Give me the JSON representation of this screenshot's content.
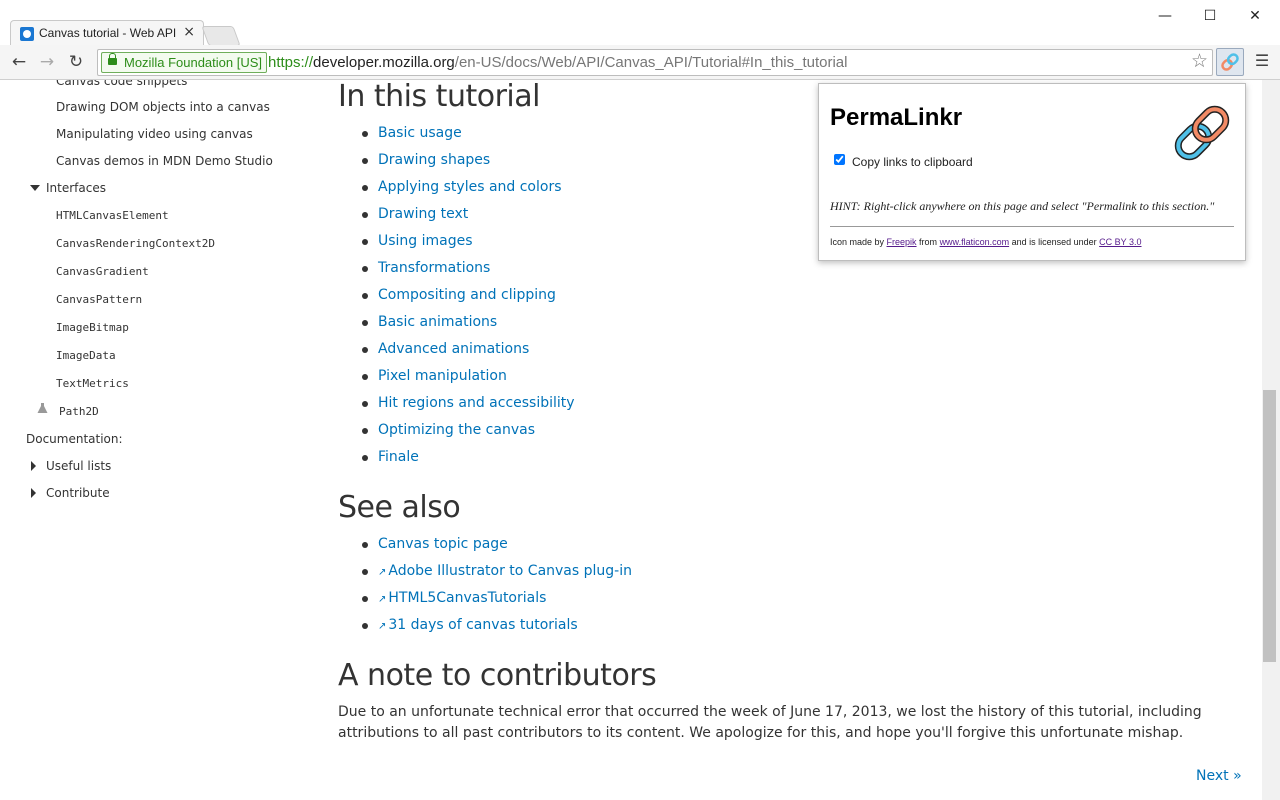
{
  "browser": {
    "tab_title": "Canvas tutorial - Web API",
    "tab_close": "×",
    "window_minimize": "—",
    "window_maximize": "☐",
    "window_close": "✕",
    "ev_badge": "Mozilla Foundation [US]",
    "url_scheme": "https://",
    "url_host": "developer.mozilla.org",
    "url_path": "/en-US/docs/Web/API/Canvas_API/Tutorial#In_this_tutorial",
    "icons": [
      "back-arrow-icon",
      "forward-arrow-icon",
      "reload-icon",
      "lock-icon",
      "star-icon",
      "permalinkr-extension-icon",
      "menu-icon"
    ],
    "accent_color": "#2d8d1a"
  },
  "sidebar": {
    "items_top": [
      {
        "label": "Canvas code snippets"
      },
      {
        "label": "Drawing DOM objects into a canvas"
      },
      {
        "label": "Manipulating video using canvas"
      },
      {
        "label": "Canvas demos in MDN Demo Studio"
      }
    ],
    "interfaces_label": "Interfaces",
    "interfaces": [
      {
        "label": "HTMLCanvasElement"
      },
      {
        "label": "CanvasRenderingContext2D"
      },
      {
        "label": "CanvasGradient"
      },
      {
        "label": "CanvasPattern"
      },
      {
        "label": "ImageBitmap"
      },
      {
        "label": "ImageData"
      },
      {
        "label": "TextMetrics"
      },
      {
        "label": "Path2D"
      }
    ],
    "documentation_label": "Documentation:",
    "useful_lists_label": "Useful lists",
    "contribute_label": "Contribute"
  },
  "main": {
    "in_this_tutorial_heading": "In this tutorial",
    "tutorial_links": [
      "Basic usage",
      "Drawing shapes",
      "Applying styles and colors",
      "Drawing text",
      "Using images",
      "Transformations",
      "Compositing and clipping",
      "Basic animations",
      "Advanced animations",
      "Pixel manipulation",
      "Hit regions and accessibility",
      "Optimizing the canvas",
      "Finale"
    ],
    "see_also_heading": "See also",
    "see_also_links": [
      {
        "label": "Canvas topic page",
        "external": false
      },
      {
        "label": "Adobe Illustrator to Canvas plug-in",
        "external": true
      },
      {
        "label": "HTML5CanvasTutorials",
        "external": true
      },
      {
        "label": "31 days of canvas tutorials",
        "external": true
      }
    ],
    "note_heading": "A note to contributors",
    "note_text": "Due to an unfortunate technical error that occurred the week of June 17, 2013, we lost the history of this tutorial, including attributions to all past contributors to its content. We apologize for this, and hope you'll forgive this unfortunate mishap.",
    "next_link": "Next »",
    "link_color": "#0072b8"
  },
  "popup": {
    "title": "PermaLinkr",
    "checkbox_label": "Copy links to clipboard",
    "checkbox_checked": true,
    "hint": "HINT: Right-click anywhere on this page and select \"Permalink to this section.\"",
    "credit_prefix": "Icon made by ",
    "credit_author": "Freepik",
    "credit_from": " from ",
    "credit_site": "www.flaticon.com",
    "credit_license_text": " and is licensed under ",
    "credit_license": "CC BY 3.0",
    "chain_colors": [
      "#f28a65",
      "#4fc0e8"
    ]
  }
}
